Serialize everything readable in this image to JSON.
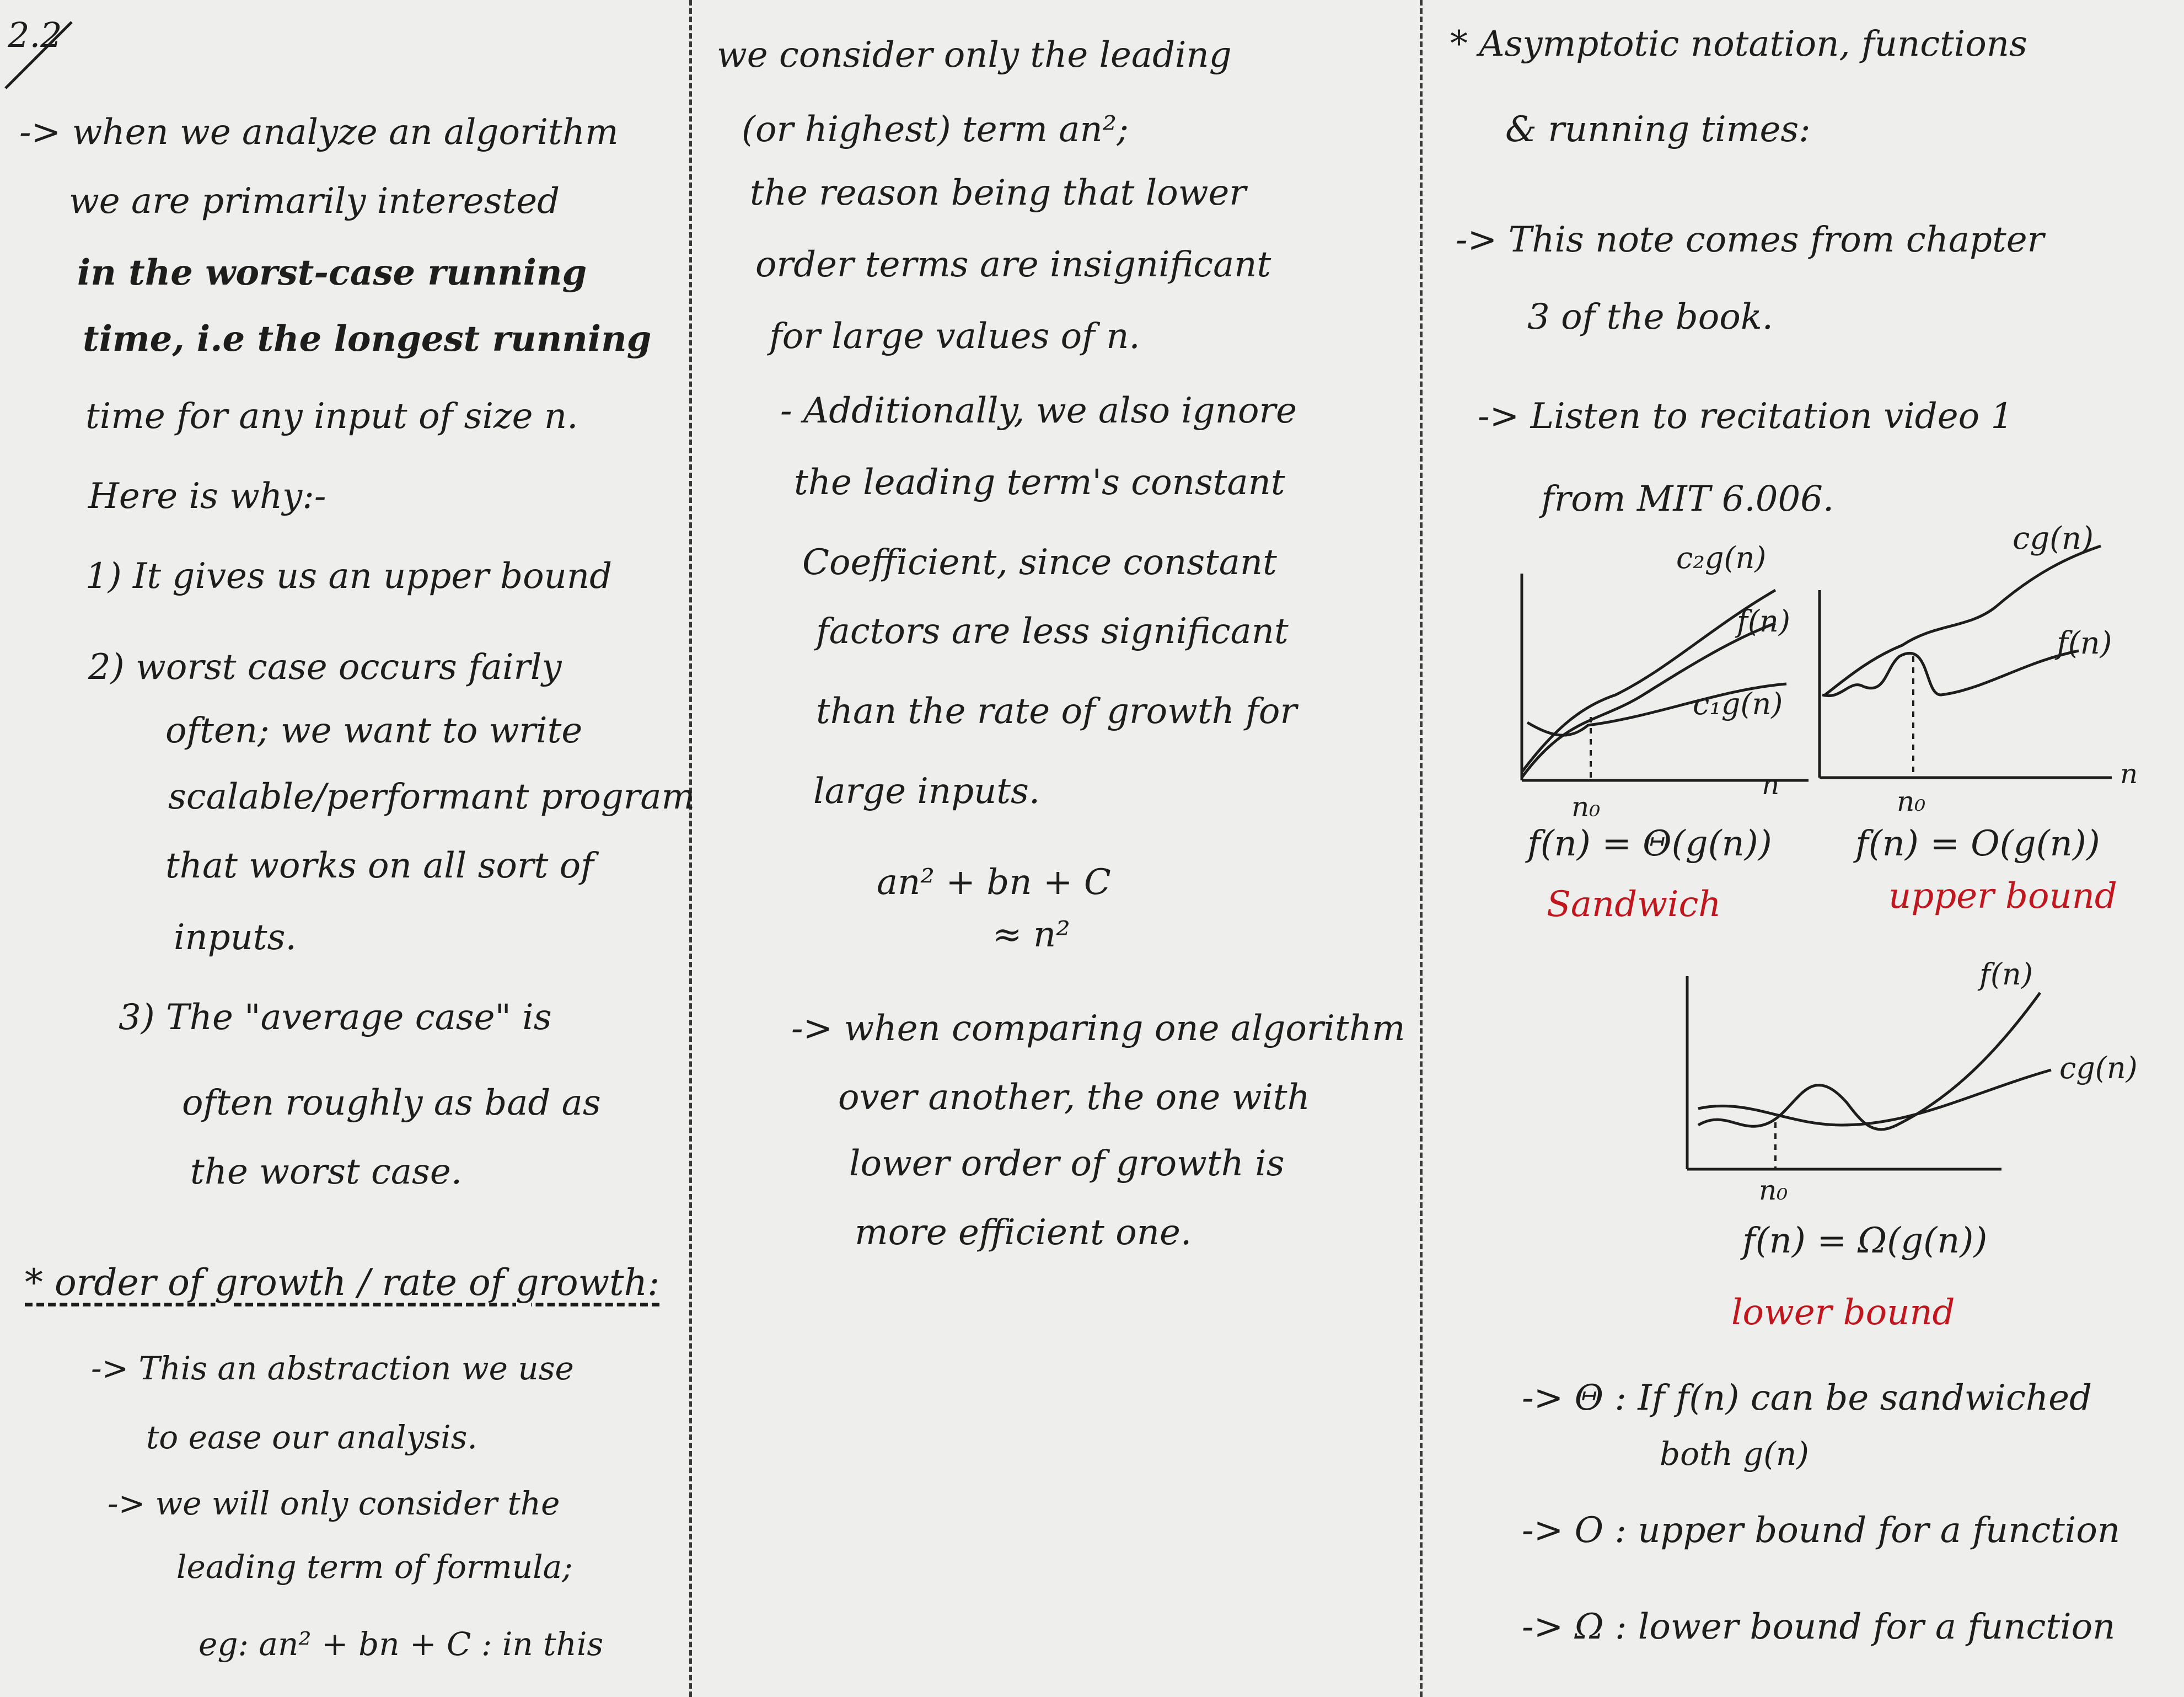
{
  "page_number": "2.2",
  "col1": {
    "intro": [
      "-> when we analyze an algorithm",
      "we are primarily interested",
      "in the worst-case running",
      "time, i.e the longest running",
      "time for any input of size n.",
      "Here is why:-"
    ],
    "reasons": [
      "1) It gives us an upper bound",
      "2) worst case occurs fairly",
      "often; we want to write",
      "scalable/performant program",
      "that works on all sort of",
      "inputs.",
      "3) The \"average case\" is",
      "often roughly as bad as",
      "the worst case."
    ],
    "order_heading": "* order of growth / rate of growth:",
    "order_lines": [
      "-> This an abstraction we use",
      "to ease our analysis.",
      "-> we will only consider the",
      "leading term of formula;",
      "eg: an² + bn + C : in this"
    ]
  },
  "col2": {
    "lines": [
      "we consider only the leading",
      "(or highest) term an²;",
      "the reason being that lower",
      "order terms are insignificant",
      "for large values of n.",
      "- Additionally, we also ignore",
      "the leading term's constant",
      "Coefficient, since constant",
      "factors are less significant",
      "than the rate of growth for",
      "large inputs."
    ],
    "formula_1": "an² + bn + C",
    "formula_2": "≈ n²",
    "compare_lines": [
      "-> when comparing one algorithm",
      "over another, the one with",
      "lower order of growth is",
      "more efficient one."
    ]
  },
  "col3": {
    "heading_1": "* Asymptotic notation, functions",
    "heading_2": "& running times:",
    "note_lines": [
      "-> This note comes from chapter",
      "3 of the book.",
      "-> Listen to recitation video 1",
      "from MIT 6.006."
    ],
    "theta_graph": {
      "labels": [
        "c₂g(n)",
        "f(n)",
        "c₁g(n)",
        "n₀",
        "n"
      ],
      "formula": "f(n) = Θ(g(n))",
      "caption": "Sandwich"
    },
    "bigo_graph": {
      "labels": [
        "cg(n)",
        "f(n)",
        "n₀",
        "n"
      ],
      "formula": "f(n) = O(g(n))",
      "caption": "upper bound"
    },
    "omega_graph": {
      "labels": [
        "f(n)",
        "cg(n)",
        "n₀"
      ],
      "formula": "f(n) = Ω(g(n))",
      "caption": "lower bound"
    },
    "summary": [
      "-> Θ : If f(n) can be sandwiched",
      "both g(n)",
      "-> O : upper bound for a function",
      "-> Ω : lower bound for a function"
    ]
  },
  "colors": {
    "ink": "#1d1d1d",
    "red_ink": "#c0161e",
    "paper": "#eeeeec"
  }
}
